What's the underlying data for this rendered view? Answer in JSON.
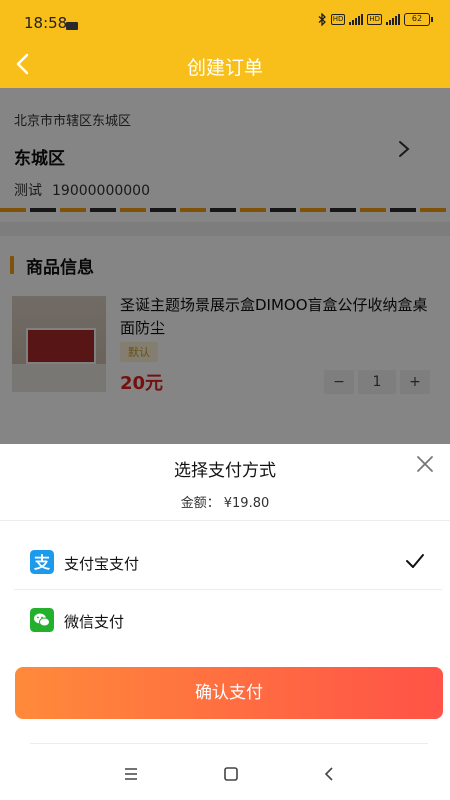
{
  "status_bar": {
    "time": "18:58",
    "hd1": "HD",
    "hd2": "HD",
    "battery": "62"
  },
  "header": {
    "title": "创建订单"
  },
  "address": {
    "region": "北京市市辖区东城区",
    "district": "东城区",
    "name": "测试",
    "phone": "19000000000"
  },
  "goods": {
    "section_title": "商品信息",
    "product_name": "圣诞主题场景展示盒DIMOO盲盒公仔收纳盒桌面防尘",
    "spec_tag": "默认",
    "price": "20元",
    "minus": "−",
    "quantity": "1",
    "plus": "+"
  },
  "payment_sheet": {
    "title": "选择支付方式",
    "amount_label": "金额：",
    "amount_value": "¥19.80",
    "options": [
      {
        "label": "支付宝支付",
        "icon": "alipay-icon",
        "selected": true
      },
      {
        "label": "微信支付",
        "icon": "wechat-icon",
        "selected": false
      }
    ],
    "confirm_label": "确认支付"
  },
  "colors": {
    "brand_yellow": "#f8bf1a",
    "price_red": "#e02020",
    "confirm_start": "#ff8a3a",
    "confirm_end": "#ff5347",
    "alipay_blue": "#1c9bec",
    "wechat_green": "#23b02d"
  }
}
